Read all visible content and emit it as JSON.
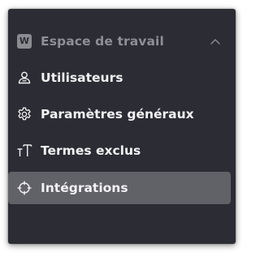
{
  "section": {
    "badge": "W",
    "title": "Espace de travail"
  },
  "items": [
    {
      "label": "Utilisateurs",
      "icon": "users-icon",
      "active": false
    },
    {
      "label": "Paramètres généraux",
      "icon": "gear-icon",
      "active": false
    },
    {
      "label": "Termes exclus",
      "icon": "text-size-icon",
      "active": false
    },
    {
      "label": "Intégrations",
      "icon": "crosshair-icon",
      "active": true
    }
  ],
  "colors": {
    "panel_bg": "#2c2c34",
    "active_bg": "#616168",
    "text": "#f2f2f4",
    "muted": "#8e8e94"
  }
}
